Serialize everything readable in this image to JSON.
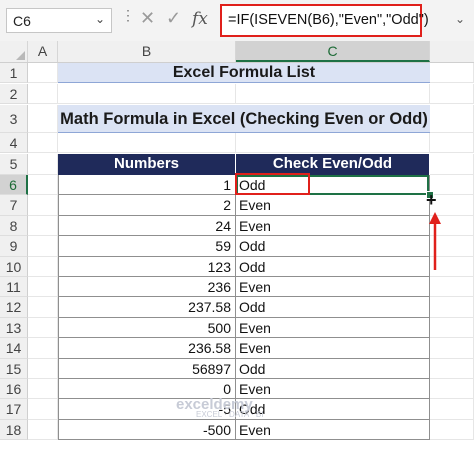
{
  "formula_bar": {
    "name_box": "C6",
    "cancel_icon": "✕",
    "enter_icon": "✓",
    "fx_label": "fx",
    "formula": "=IF(ISEVEN(B6),\"Even\",\"Odd\")"
  },
  "columns": [
    "A",
    "B",
    "C"
  ],
  "rows": [
    "1",
    "2",
    "3",
    "4",
    "5",
    "6",
    "7",
    "8",
    "9",
    "10",
    "11",
    "12",
    "13",
    "14",
    "15",
    "16",
    "17",
    "18"
  ],
  "sheet": {
    "title": "Excel Formula List",
    "subtitle": "Math Formula in Excel (Checking Even or Odd)",
    "headers": {
      "numbers": "Numbers",
      "check": "Check Even/Odd"
    },
    "data": [
      {
        "number": "1",
        "result": "Odd"
      },
      {
        "number": "2",
        "result": "Even"
      },
      {
        "number": "24",
        "result": "Even"
      },
      {
        "number": "59",
        "result": "Odd"
      },
      {
        "number": "123",
        "result": "Odd"
      },
      {
        "number": "236",
        "result": "Even"
      },
      {
        "number": "237.58",
        "result": "Odd"
      },
      {
        "number": "500",
        "result": "Even"
      },
      {
        "number": "236.58",
        "result": "Even"
      },
      {
        "number": "56897",
        "result": "Odd"
      },
      {
        "number": "0",
        "result": "Even"
      },
      {
        "number": "-5",
        "result": "Odd"
      },
      {
        "number": "-500",
        "result": "Even"
      }
    ]
  },
  "watermark": {
    "name": "exceldemy",
    "tagline": "EXCEL · DATA · BI"
  },
  "colors": {
    "header_bg": "#1f2a5a",
    "title_bg": "#dbe3f4",
    "highlight_red": "#e0201b",
    "selection_green": "#1e7145"
  }
}
